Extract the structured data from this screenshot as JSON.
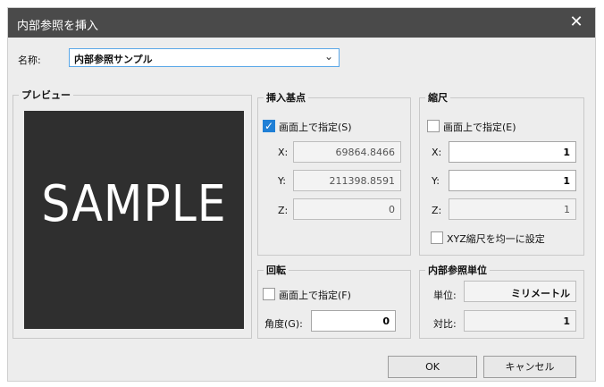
{
  "window": {
    "title": "内部参照を挿入",
    "close_glyph": "✕"
  },
  "name": {
    "label": "名称:",
    "value": "内部参照サンプル"
  },
  "preview": {
    "legend": "プレビュー",
    "text": "SAMPLE"
  },
  "insert_point": {
    "legend": "挿入基点",
    "specify": "画面上で指定(S)",
    "specify_checked": true,
    "x_label": "X:",
    "x_value": "69864.8466",
    "y_label": "Y:",
    "y_value": "211398.8591",
    "z_label": "Z:",
    "z_value": "0"
  },
  "scale": {
    "legend": "縮尺",
    "specify": "画面上で指定(E)",
    "x_label": "X:",
    "x_value": "1",
    "y_label": "Y:",
    "y_value": "1",
    "z_label": "Z:",
    "z_value": "1",
    "uniform": "XYZ縮尺を均一に設定"
  },
  "rotation": {
    "legend": "回転",
    "specify": "画面上で指定(F)",
    "angle_label": "角度(G):",
    "angle_value": "0"
  },
  "units": {
    "legend": "内部参照単位",
    "unit_label": "単位:",
    "unit_value": "ミリメートル",
    "ratio_label": "対比:",
    "ratio_value": "1"
  },
  "buttons": {
    "ok": "OK",
    "cancel": "キャンセル"
  }
}
